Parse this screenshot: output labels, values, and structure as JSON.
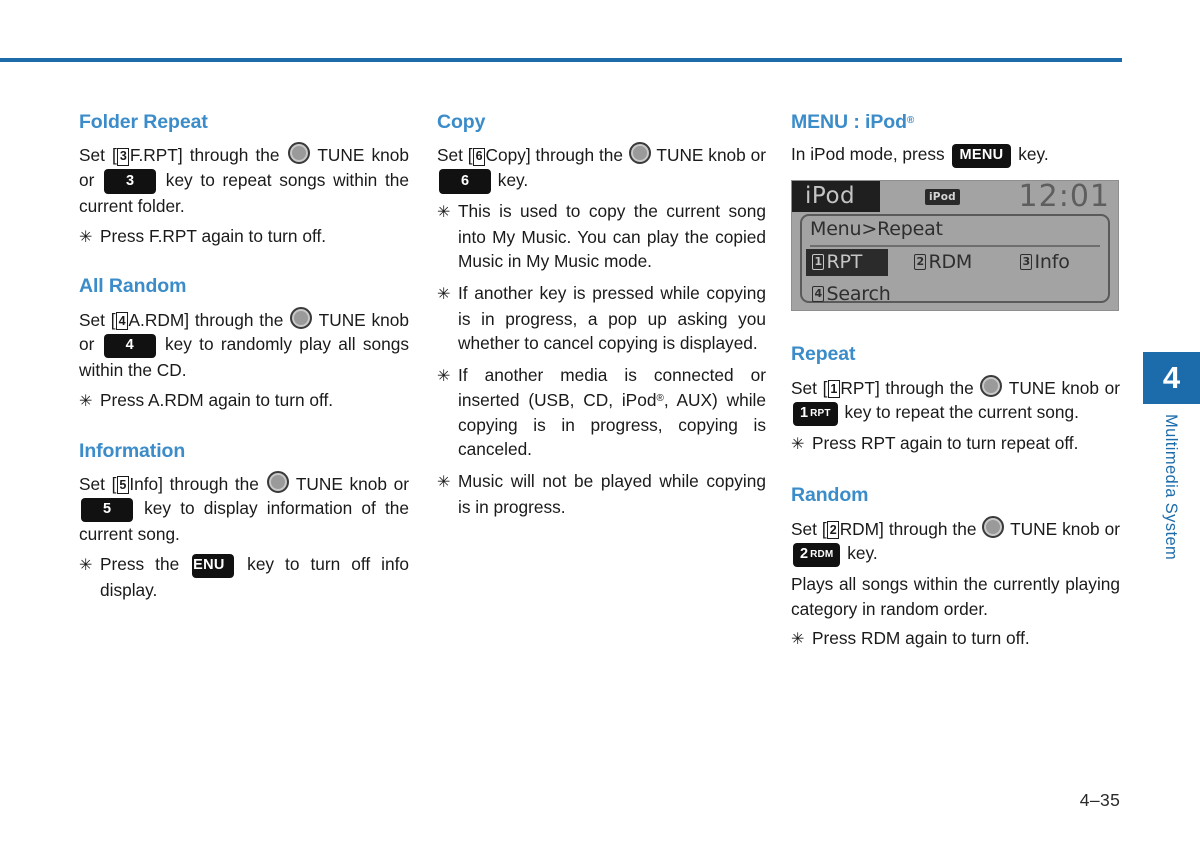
{
  "page": {
    "number": "4–35",
    "chapter_number": "4",
    "chapter_label": "Multimedia System",
    "accent_color": "#1c6cab",
    "heading_color": "#3b8cc9"
  },
  "column_left": {
    "sections": [
      {
        "title": "Folder Repeat",
        "line_1_a": "Set [",
        "line_1_boxnum": "3",
        "line_1_b": "F.RPT] through the ",
        "knob_icon": "tune-knob-icon",
        "line_1_c": " TUNE knob or ",
        "key_badge": "3",
        "line_1_d": " key to repeat songs within the current folder.",
        "bullets": [
          {
            "marker": "✳",
            "text": "Press F.RPT again to turn off."
          }
        ]
      },
      {
        "title": "All Random",
        "line_1_a": "Set [",
        "line_1_boxnum": "4",
        "line_1_b": "A.RDM] through the ",
        "knob_icon": "tune-knob-icon",
        "line_1_c": " TUNE knob or ",
        "key_badge": "4",
        "line_1_d": " key to randomly play all songs within the CD.",
        "bullets": [
          {
            "marker": "✳",
            "text": "Press A.RDM again to turn off."
          }
        ]
      },
      {
        "title": "Information",
        "line_1_a": "Set [",
        "line_1_boxnum": "5",
        "line_1_b": "Info] through the ",
        "knob_icon": "tune-knob-icon",
        "line_1_c": " TUNE knob or ",
        "key_badge": "5",
        "line_1_d": " key to display information of the current song.",
        "bullets": [
          {
            "marker": "✳",
            "text_before": "Press the ",
            "key_badge": "MENU",
            "text_after": " key to turn off info display."
          }
        ]
      }
    ]
  },
  "column_middle": {
    "sections": [
      {
        "title": "Copy",
        "line_1_a": "Set [",
        "line_1_boxnum": "6",
        "line_1_b": "Copy] through the ",
        "knob_icon": "tune-knob-icon",
        "line_1_c": " TUNE knob or ",
        "key_badge": "6",
        "line_1_d": " key.",
        "bullets": [
          {
            "marker": "✳",
            "text": "This is used to copy the current song into My Music. You can play the copied Music in My Music mode."
          },
          {
            "marker": "✳",
            "text": "If another key is pressed while copying is in progress, a pop up asking you whether to cancel copying is displayed."
          },
          {
            "marker": "✳",
            "text_a": "If another media is connected or inserted (USB, CD, iPod",
            "reg": "®",
            "text_b": ", AUX) while copying is in progress, copying is canceled."
          },
          {
            "marker": "✳",
            "text": "Music will not be played while copying is in progress."
          }
        ]
      }
    ]
  },
  "column_right": {
    "menu_section": {
      "title_a": "MENU : iPod",
      "title_reg": "®",
      "intro_a": "In iPod mode, press ",
      "intro_key": "MENU",
      "intro_b": " key."
    },
    "lcd": {
      "mode_label": "iPod",
      "source_badge": "iPod",
      "clock": "12:01",
      "breadcrumb": "Menu>Repeat",
      "items": [
        {
          "num": "1",
          "label": "RPT",
          "selected": true
        },
        {
          "num": "2",
          "label": "RDM",
          "selected": false
        },
        {
          "num": "3",
          "label": "Info",
          "selected": false
        },
        {
          "num": "4",
          "label": "Search",
          "selected": false
        }
      ]
    },
    "sections": [
      {
        "title": "Repeat",
        "line_1_a": "Set [",
        "line_1_boxnum": "1",
        "line_1_b": "RPT] through the ",
        "knob_icon": "tune-knob-icon",
        "line_1_c": " TUNE knob or ",
        "key_badge_num": "1",
        "key_badge_sub": "RPT",
        "line_1_d": " key to repeat the current song.",
        "bullets": [
          {
            "marker": "✳",
            "text": "Press RPT again to turn repeat off."
          }
        ]
      },
      {
        "title": "Random",
        "line_1_a": "Set [",
        "line_1_boxnum": "2",
        "line_1_b": "RDM] through the ",
        "knob_icon": "tune-knob-icon",
        "line_1_c": " TUNE knob or ",
        "key_badge_num": "2",
        "key_badge_sub": "RDM",
        "line_1_d": " key.",
        "extra_paragraph": "Plays all songs within the currently playing category in random order.",
        "bullets": [
          {
            "marker": "✳",
            "text": "Press RDM again to turn off."
          }
        ]
      }
    ]
  }
}
